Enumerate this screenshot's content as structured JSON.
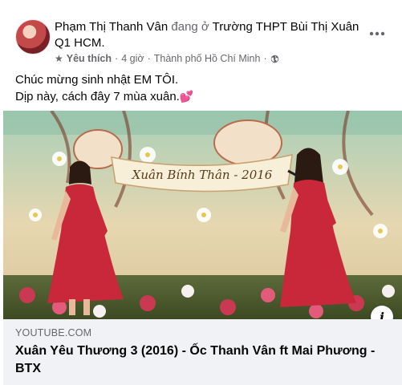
{
  "post": {
    "author": "Phạm Thị Thanh Vân",
    "verb": "đang ở",
    "place": "Trường THPT Bùi Thị Xuân Q1 HCM.",
    "meta": {
      "audience_label": "Yêu thích",
      "separator": "·",
      "time": "4 giờ",
      "location": "Thành phố Hồ Chí Minh"
    },
    "body_line1": "Chúc mừng sinh nhật EM TÔI.",
    "body_line2": "Dịp này, cách đây 7 mùa xuân.",
    "body_emoji": "💕"
  },
  "media": {
    "banner_text": "Xuân Bính Thân - 2016"
  },
  "link_preview": {
    "domain": "YOUTUBE.COM",
    "title": "Xuân Yêu Thương 3 (2016) - Ốc Thanh Vân ft Mai Phương - BTX"
  },
  "icons": {
    "star": "star-icon",
    "globe": "globe-icon",
    "more": "more-options-icon",
    "info": "info-icon"
  }
}
